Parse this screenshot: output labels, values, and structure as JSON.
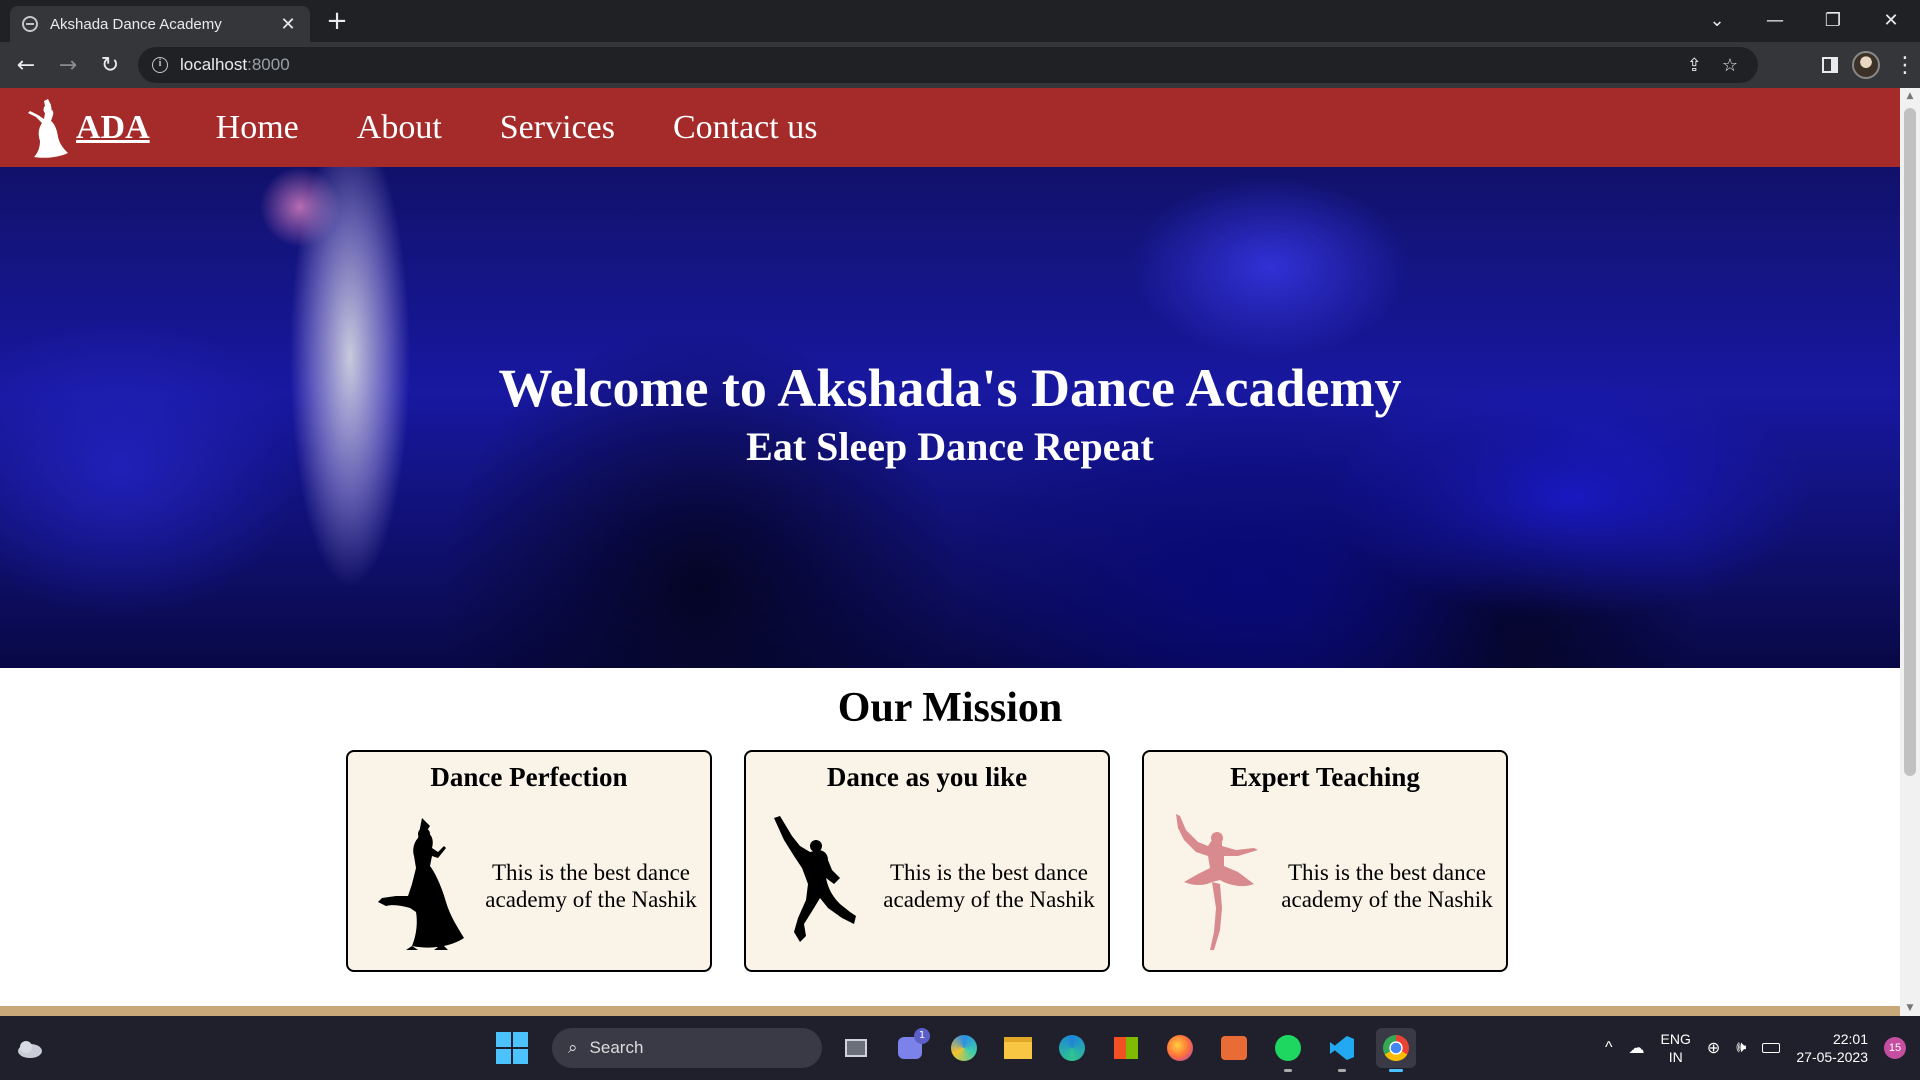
{
  "browser": {
    "tab": {
      "title": "Akshada Dance Academy",
      "close": "✕"
    },
    "new_tab": "+",
    "window_controls": [
      "⌄",
      "—",
      "❐",
      "✕"
    ],
    "nav": {
      "back": "←",
      "forward": "→",
      "reload": "↻"
    },
    "url": {
      "host": "localhost",
      "port": ":8000"
    },
    "omnibox_icons": {
      "share": "⇪",
      "bookmark": "☆"
    },
    "menu": "⋮"
  },
  "site": {
    "logo_text": "ADA",
    "menu": [
      "Home",
      "About",
      "Services",
      "Contact us"
    ],
    "hero": {
      "title": "Welcome to Akshada's Dance Academy",
      "subtitle": "Eat Sleep Dance Repeat"
    },
    "mission_title": "Our Mission",
    "cards": [
      {
        "title": "Dance Perfection",
        "text": "This is the best dance academy of the Nashik",
        "icon": "kathak-dancer-silhouette"
      },
      {
        "title": "Dance as you like",
        "text": "This is the best dance academy of the Nashik",
        "icon": "jumping-dancer-silhouette"
      },
      {
        "title": "Expert Teaching",
        "text": "This is the best dance academy of the Nashik",
        "icon": "ballerina-silhouette"
      }
    ]
  },
  "colors": {
    "nav_bg": "#a52a2a",
    "card_bg": "#faf3e8",
    "ballerina": "#d98a8e"
  },
  "taskbar": {
    "search_placeholder": "Search",
    "lang": [
      "ENG",
      "IN"
    ],
    "time": "22:01",
    "date": "27-05-2023",
    "notifications": "15",
    "teams_badge": "1"
  }
}
